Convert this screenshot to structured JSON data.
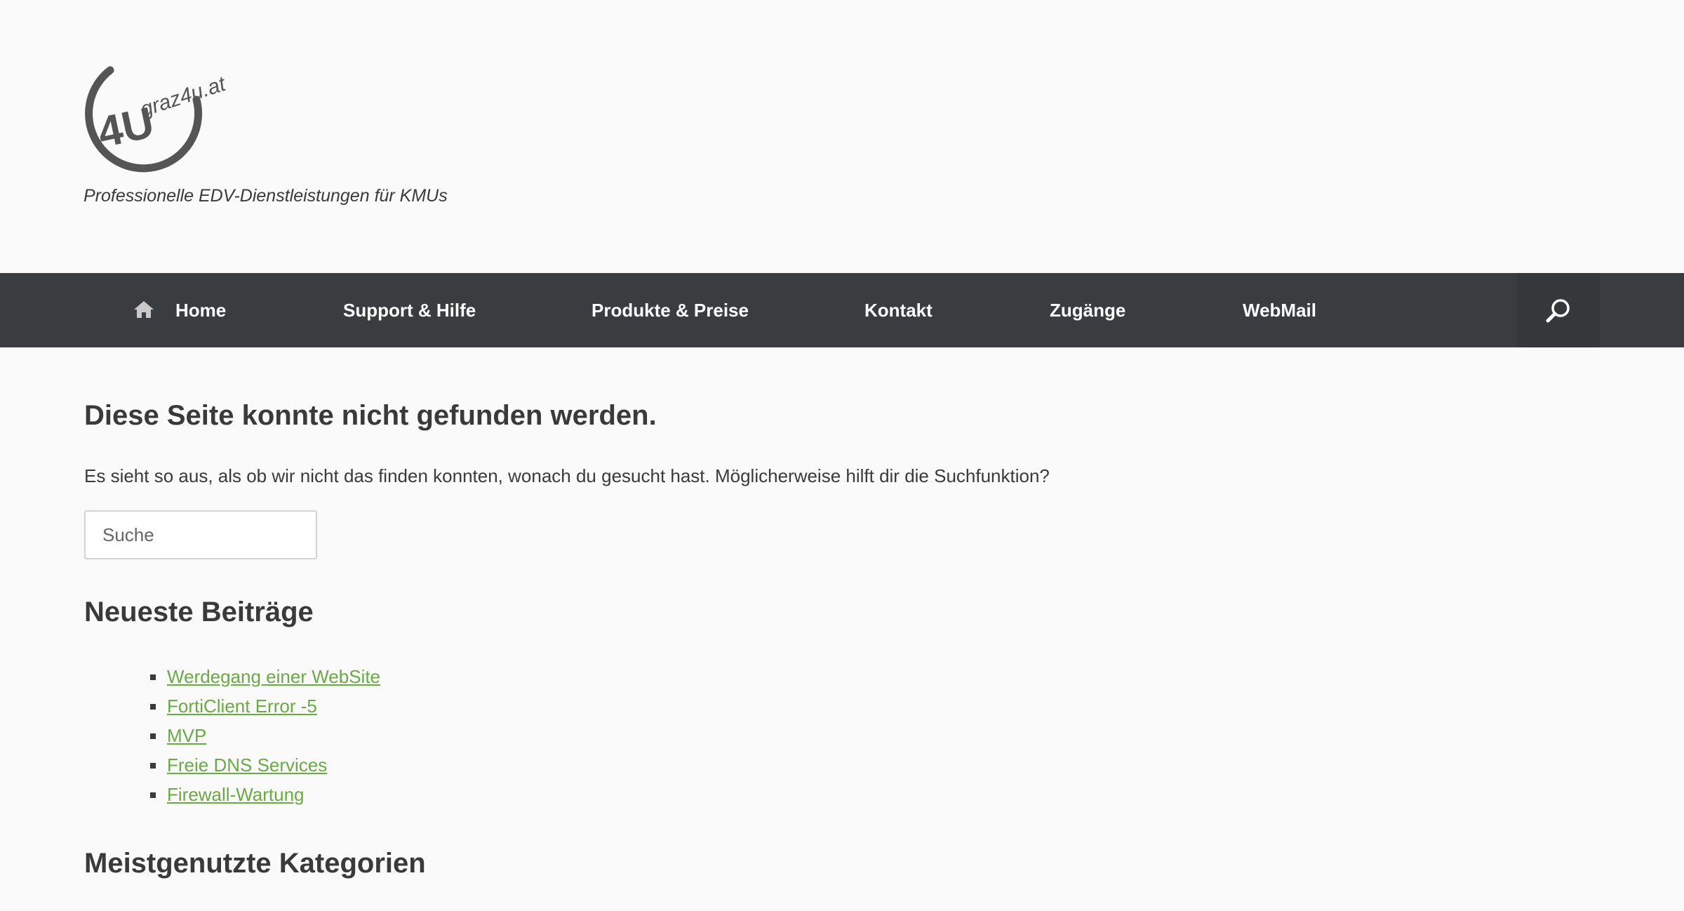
{
  "header": {
    "logo_text": "graz4u.at",
    "logo_mark": "4U",
    "tagline": "Professionelle EDV-Dienstleistungen für KMUs"
  },
  "nav": {
    "items": [
      {
        "label": "Home",
        "icon": "home-icon"
      },
      {
        "label": "Support & Hilfe"
      },
      {
        "label": "Produkte & Preise"
      },
      {
        "label": "Kontakt"
      },
      {
        "label": "Zugänge"
      },
      {
        "label": "WebMail"
      }
    ],
    "search_icon": "search-icon"
  },
  "main": {
    "title": "Diese Seite konnte nicht gefunden werden.",
    "intro": "Es sieht so aus, als ob wir nicht das finden konnten, wonach du gesucht hast. Möglicherweise hilft dir die Suchfunktion?",
    "search_placeholder": "Suche",
    "recent_posts_title": "Neueste Beiträge",
    "recent_posts": [
      "Werdegang einer WebSite",
      "FortiClient Error -5",
      "MVP",
      "Freie DNS Services",
      "Firewall-Wartung"
    ],
    "categories_title": "Meistgenutzte Kategorien"
  },
  "colors": {
    "navbar": "#3a3c40",
    "link": "#6aaa44",
    "text": "#3a3a3a",
    "background": "#fafafa"
  }
}
